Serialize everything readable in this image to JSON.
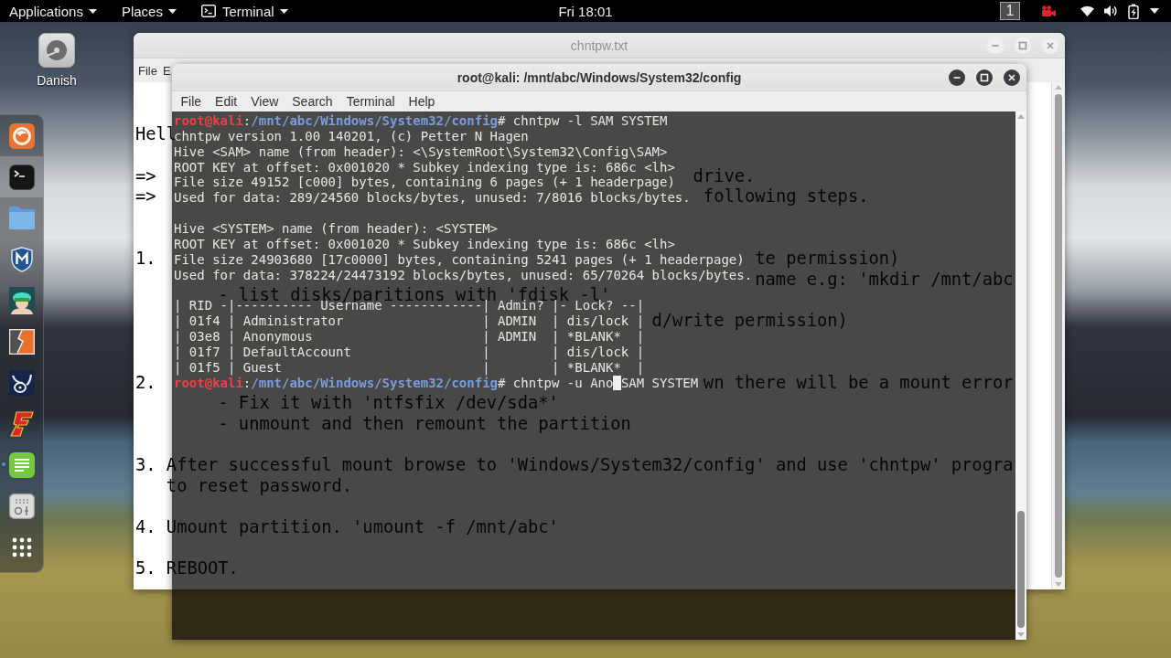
{
  "top_bar": {
    "menus": [
      {
        "label": "Applications",
        "kind": "menu"
      },
      {
        "label": "Places",
        "kind": "menu"
      },
      {
        "label": "Terminal",
        "kind": "app"
      }
    ],
    "clock": "Fri 18:01",
    "workspace": "1"
  },
  "desktop_icons": [
    {
      "label": "Danish"
    }
  ],
  "dock": {
    "items": [
      {
        "selected": false,
        "running": false
      },
      {
        "selected": true,
        "running": false
      },
      {
        "selected": false,
        "running": false
      },
      {
        "selected": false,
        "running": false
      },
      {
        "selected": false,
        "running": false
      },
      {
        "selected": false,
        "running": false
      },
      {
        "selected": false,
        "running": false
      },
      {
        "selected": false,
        "running": false
      },
      {
        "selected": false,
        "running": true
      },
      {
        "selected": false,
        "running": false
      },
      {
        "selected": false,
        "running": false
      }
    ]
  },
  "editor_window": {
    "title": "chntpw.txt",
    "active": false,
    "menu": [
      "File",
      "E"
    ],
    "lines": [
      {
        "segments": [
          "Hell"
        ]
      },
      {
        "segments": [
          "=>",
          "drive."
        ]
      },
      {
        "segments": [
          "=>",
          "following steps."
        ]
      },
      {
        "segments": [
          "1.",
          "te permission)"
        ]
      },
      {
        "segments": [
          "name e.g: 'mkdir /mnt/abc"
        ]
      },
      {
        "segments": [
          "- list disks/paritions with 'fdisk -l'"
        ]
      },
      {
        "segments": [
          "d/write permission)"
        ]
      },
      {
        "segments": [
          "2.",
          "wn there will be a mount error"
        ]
      },
      {
        "segments": [
          "- Fix it with 'ntfsfix /dev/sda*'"
        ]
      },
      {
        "segments": [
          "- unmount and then remount the partition"
        ]
      },
      {
        "segments": [
          "3. After successful mount browse to 'Windows/System32/config' and use 'chntpw' progra"
        ]
      },
      {
        "segments": [
          "to reset password."
        ]
      },
      {
        "segments": [
          "4. Umount partition. 'umount -f /mnt/abc'"
        ]
      },
      {
        "segments": [
          "5. REBOOT."
        ]
      }
    ]
  },
  "terminal_window": {
    "title": "root@kali: /mnt/abc/Windows/System32/config",
    "active": true,
    "menu": [
      "File",
      "Edit",
      "View",
      "Search",
      "Terminal",
      "Help"
    ],
    "lines": [
      {
        "kind": "prompt",
        "user": "root@kali",
        "sep": ":",
        "path": "/mnt/abc/Windows/System32/config",
        "command": "# chntpw -l SAM SYSTEM"
      },
      {
        "kind": "output",
        "text": "chntpw version 1.00 140201, (c) Petter N Hagen"
      },
      {
        "kind": "output",
        "text": "Hive <SAM> name (from header): <\\SystemRoot\\System32\\Config\\SAM>"
      },
      {
        "kind": "output",
        "text": "ROOT KEY at offset: 0x001020 * Subkey indexing type is: 686c <lh>"
      },
      {
        "kind": "output",
        "text": "File size 49152 [c000] bytes, containing 6 pages (+ 1 headerpage)"
      },
      {
        "kind": "output",
        "text": "Used for data: 289/24560 blocks/bytes, unused: 7/8016 blocks/bytes."
      },
      {
        "kind": "blank"
      },
      {
        "kind": "output",
        "text": "Hive <SYSTEM> name (from header): <SYSTEM>"
      },
      {
        "kind": "output",
        "text": "ROOT KEY at offset: 0x001020 * Subkey indexing type is: 686c <lh>"
      },
      {
        "kind": "output",
        "text": "File size 24903680 [17c0000] bytes, containing 5241 pages (+ 1 headerpage)"
      },
      {
        "kind": "output",
        "text": "Used for data: 378224/24473192 blocks/bytes, unused: 65/70264 blocks/bytes."
      },
      {
        "kind": "blank"
      },
      {
        "kind": "output",
        "text": "| RID -|---------- Username ------------| Admin? |- Lock? --|"
      },
      {
        "kind": "output",
        "text": "| 01f4 | Administrator                  | ADMIN  | dis/lock |"
      },
      {
        "kind": "output",
        "text": "| 03e8 | Anonymous                      | ADMIN  | *BLANK*  |"
      },
      {
        "kind": "output",
        "text": "| 01f7 | DefaultAccount                 |        | dis/lock |"
      },
      {
        "kind": "output",
        "text": "| 01f5 | Guest                          |        | *BLANK*  |"
      },
      {
        "kind": "input",
        "user": "root@kali",
        "sep": ":",
        "path": "/mnt/abc/Windows/System32/config",
        "command": "# chntpw -u Ano",
        "after_cursor": "SAM SYSTEM"
      }
    ]
  }
}
